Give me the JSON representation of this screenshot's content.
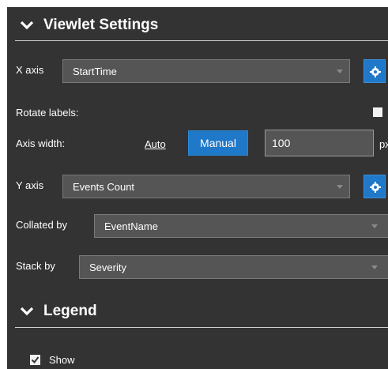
{
  "viewlet_settings": {
    "title": "Viewlet Settings",
    "x_axis": {
      "label": "X axis",
      "value": "StartTime"
    },
    "rotate_labels": {
      "label": "Rotate labels:",
      "checked": false
    },
    "axis_width": {
      "label": "Axis width:",
      "auto_label": "Auto",
      "manual_label": "Manual",
      "value": "100",
      "unit": "px"
    },
    "y_axis": {
      "label": "Y axis",
      "value": "Events Count"
    },
    "collated_by": {
      "label": "Collated by",
      "value": "EventName"
    },
    "stack_by": {
      "label": "Stack by",
      "value": "Severity"
    }
  },
  "legend": {
    "title": "Legend",
    "show": {
      "label": "Show",
      "checked": true
    }
  },
  "colors": {
    "panel_bg": "#333333",
    "accent": "#1f78c8",
    "field_bg": "#555555"
  },
  "icons": {
    "collapse": "chevron-down-icon",
    "settings": "gear-icon",
    "checkbox": "checkbox-icon"
  }
}
